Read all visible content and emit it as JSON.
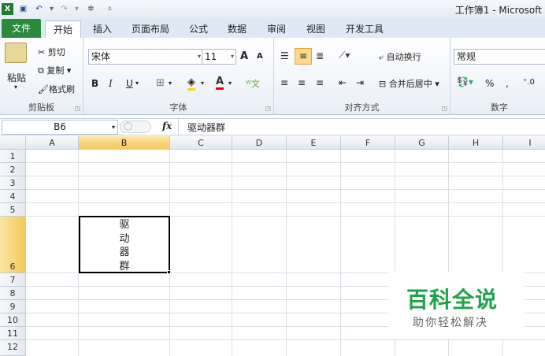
{
  "window": {
    "title": "工作簿1 - Microsoft"
  },
  "tabs": [
    "文件",
    "开始",
    "插入",
    "页面布局",
    "公式",
    "数据",
    "审阅",
    "视图",
    "开发工具"
  ],
  "clipboard": {
    "paste": "粘贴",
    "cut": "剪切",
    "copy": "复制",
    "format_painter": "格式刷",
    "label": "剪贴板"
  },
  "font": {
    "name": "宋体",
    "size": "11",
    "bold": "B",
    "italic": "I",
    "underline": "U",
    "label": "字体",
    "grow": "A",
    "shrink": "A"
  },
  "alignment": {
    "wrap_text": "自动换行",
    "merge_center": "合并后居中",
    "label": "对齐方式"
  },
  "number": {
    "format": "常规",
    "percent": "%",
    "comma": ",",
    "label": "数字"
  },
  "formula_bar": {
    "name_box": "B6",
    "fx": "fx",
    "content": "驱动器群"
  },
  "columns": [
    "A",
    "B",
    "C",
    "D",
    "E",
    "F",
    "G",
    "H",
    "I"
  ],
  "rows": [
    "1",
    "2",
    "3",
    "4",
    "5",
    "6",
    "7",
    "8",
    "9",
    "10",
    "11",
    "12"
  ],
  "cell": {
    "address": "B6",
    "lines": [
      "驱",
      "动",
      "器",
      "群"
    ]
  },
  "watermark": {
    "title": "百科全说",
    "subtitle": "助你轻松解决"
  },
  "colors": {
    "file_tab": "#2a8a3e",
    "selected_header": "#f5c85a",
    "watermark_green": "#1fa34a"
  }
}
